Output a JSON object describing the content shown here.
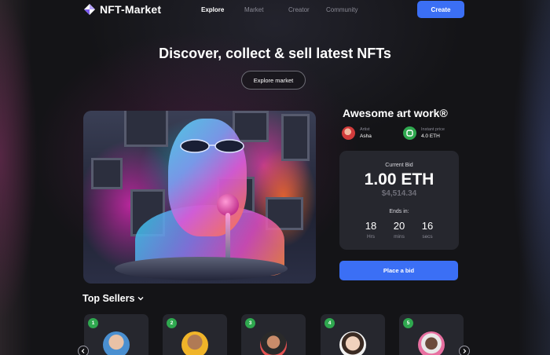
{
  "brand": {
    "name": "NFT-Market"
  },
  "nav": {
    "links": [
      {
        "label": "Explore",
        "active": true
      },
      {
        "label": "Market",
        "active": false
      },
      {
        "label": "Creator",
        "active": false
      },
      {
        "label": "Community",
        "active": false
      }
    ],
    "create_label": "Create"
  },
  "hero": {
    "title": "Discover, collect & sell latest NFTs",
    "explore_label": "Explore market"
  },
  "artwork": {
    "title": "Awesome art work®",
    "artist_label": "Artist",
    "artist_name": "Asha",
    "price_label": "Instant price",
    "price_value": "4.0 ETH"
  },
  "bid": {
    "label": "Current Bid",
    "amount": "1.00 ETH",
    "usd": "$4,514.34",
    "ends_label": "Ends in:",
    "countdown": [
      {
        "value": "18",
        "unit": "Hrs"
      },
      {
        "value": "20",
        "unit": "mins"
      },
      {
        "value": "16",
        "unit": "secs"
      }
    ],
    "place_label": "Place a bid"
  },
  "sellers": {
    "title": "Top Sellers",
    "items": [
      {
        "rank": "1"
      },
      {
        "rank": "2"
      },
      {
        "rank": "3"
      },
      {
        "rank": "4"
      },
      {
        "rank": "5"
      }
    ]
  },
  "colors": {
    "accent": "#3b6ff5",
    "badge": "#2fa84f",
    "card": "#26272e",
    "background": "#141417"
  }
}
